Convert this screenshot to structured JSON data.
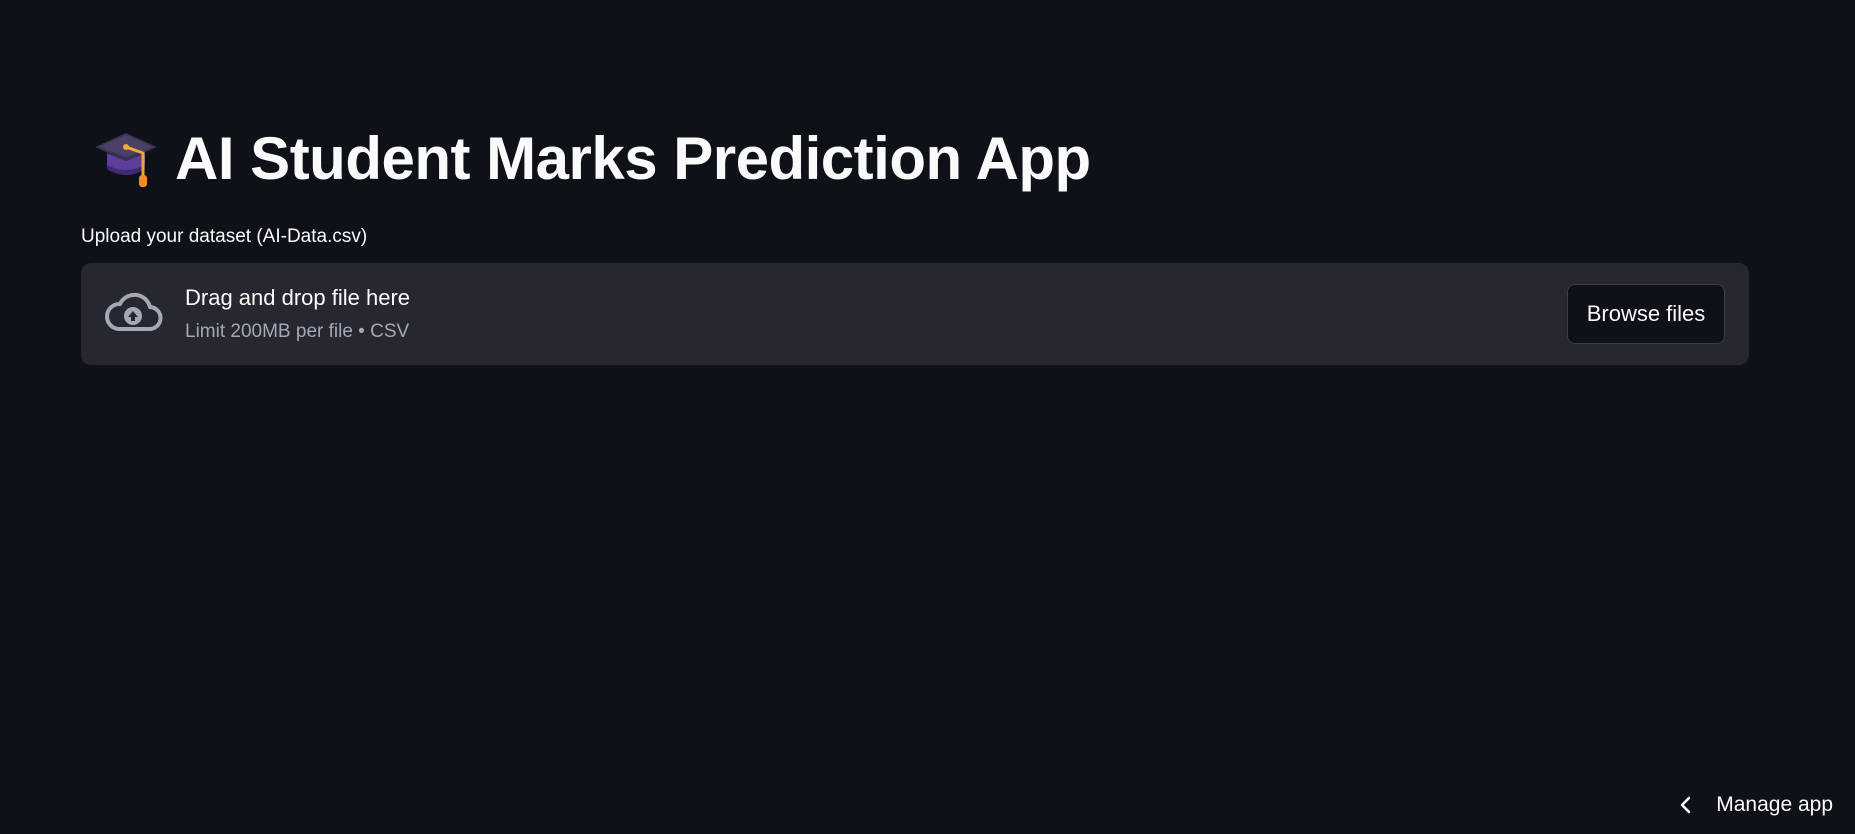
{
  "header": {
    "title_emoji": "graduation-cap-icon",
    "title": "AI Student Marks Prediction App"
  },
  "uploader": {
    "label": "Upload your dataset (AI-Data.csv)",
    "drop_title": "Drag and drop file here",
    "drop_subtitle": "Limit 200MB per file • CSV",
    "icon": "cloud-upload-icon",
    "browse_label": "Browse files"
  },
  "footer": {
    "manage_label": "Manage app",
    "icon": "chevron-left-icon"
  },
  "colors": {
    "background": "#0e1117",
    "dropzone": "#262730",
    "text": "#fafafa",
    "muted_text": "#a3a8b4"
  }
}
